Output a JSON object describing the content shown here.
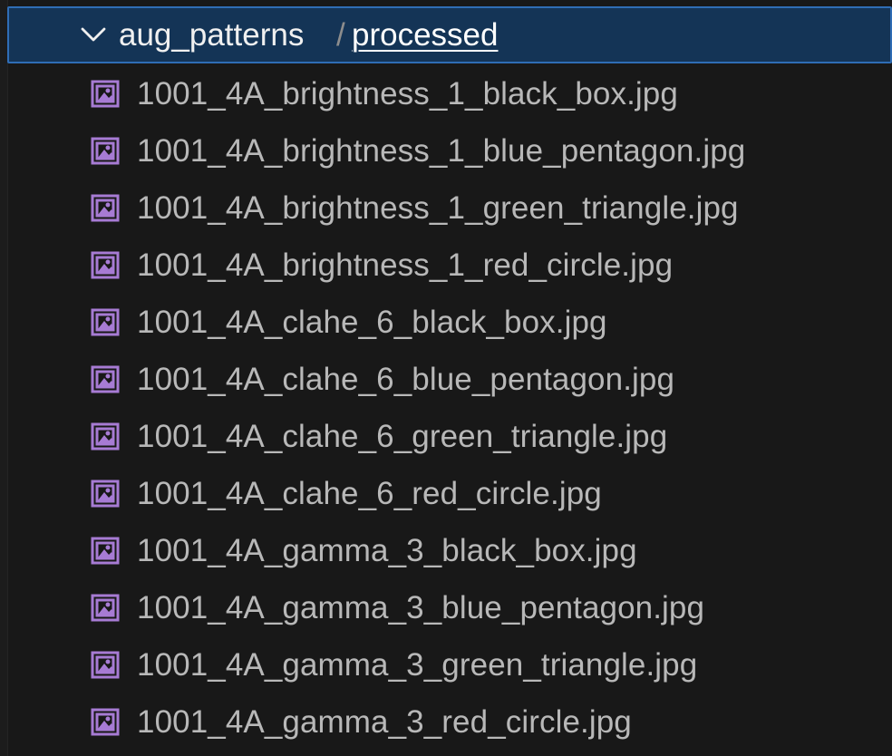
{
  "explorer": {
    "folder": {
      "name": "aug_patterns",
      "separator": "/",
      "subfolder": "processed",
      "expanded": true,
      "chevron_icon": "chevron-down-icon"
    },
    "files": [
      {
        "name": "1001_4A_brightness_1_black_box.jpg",
        "icon": "image-file-icon"
      },
      {
        "name": "1001_4A_brightness_1_blue_pentagon.jpg",
        "icon": "image-file-icon"
      },
      {
        "name": "1001_4A_brightness_1_green_triangle.jpg",
        "icon": "image-file-icon"
      },
      {
        "name": "1001_4A_brightness_1_red_circle.jpg",
        "icon": "image-file-icon"
      },
      {
        "name": "1001_4A_clahe_6_black_box.jpg",
        "icon": "image-file-icon"
      },
      {
        "name": "1001_4A_clahe_6_blue_pentagon.jpg",
        "icon": "image-file-icon"
      },
      {
        "name": "1001_4A_clahe_6_green_triangle.jpg",
        "icon": "image-file-icon"
      },
      {
        "name": "1001_4A_clahe_6_red_circle.jpg",
        "icon": "image-file-icon"
      },
      {
        "name": "1001_4A_gamma_3_black_box.jpg",
        "icon": "image-file-icon"
      },
      {
        "name": "1001_4A_gamma_3_blue_pentagon.jpg",
        "icon": "image-file-icon"
      },
      {
        "name": "1001_4A_gamma_3_green_triangle.jpg",
        "icon": "image-file-icon"
      },
      {
        "name": "1001_4A_gamma_3_red_circle.jpg",
        "icon": "image-file-icon"
      }
    ]
  },
  "colors": {
    "background": "#181818",
    "selection_background": "#143456",
    "selection_border": "#2f6db5",
    "folder_text": "#f0f0f0",
    "file_text": "#b8b8b8",
    "image_icon": "#a77bd4"
  }
}
